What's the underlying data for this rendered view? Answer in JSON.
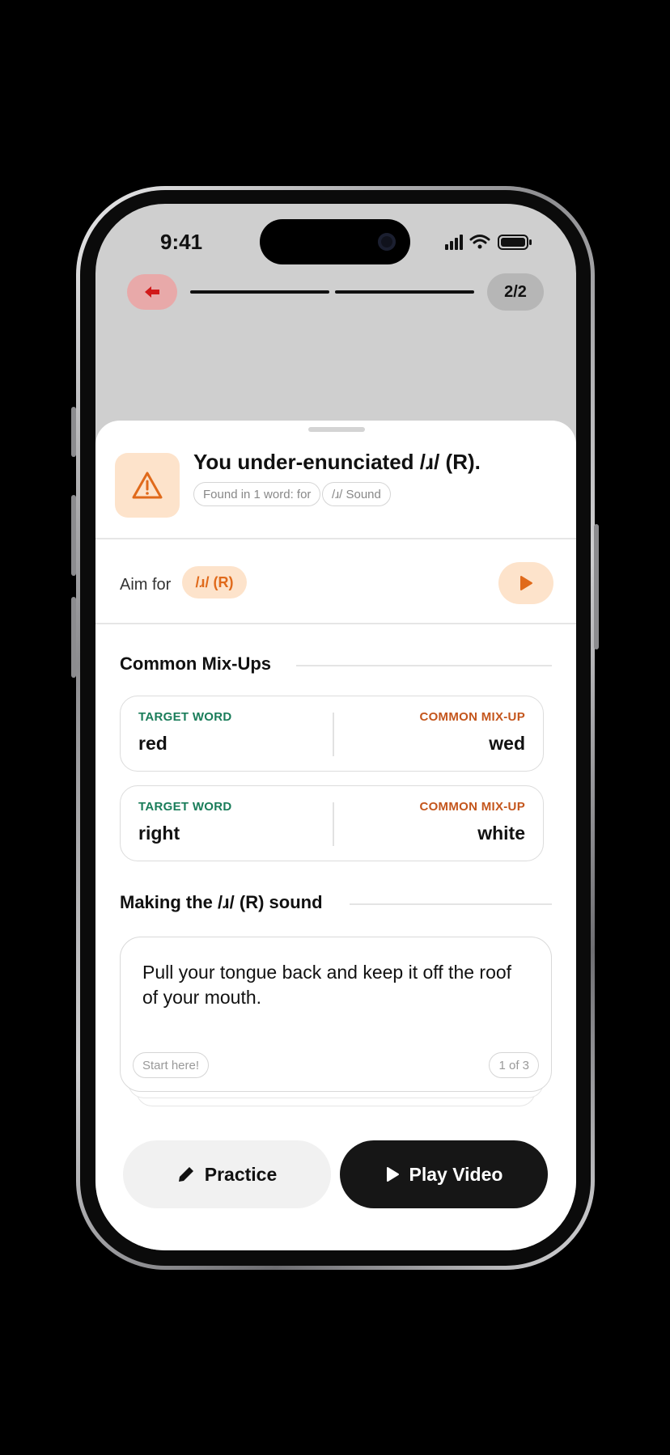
{
  "status_bar": {
    "time": "9:41"
  },
  "nav": {
    "page_indicator": "2/2"
  },
  "issue": {
    "title": "You under-enunciated /ɹ/ (R).",
    "found_chip": "Found in 1 word: for",
    "sound_chip": "/ɹ/ Sound"
  },
  "aim": {
    "label": "Aim for",
    "sound": "/ɹ/ (R)"
  },
  "mixups": {
    "title": "Common Mix-Ups",
    "target_label": "TARGET WORD",
    "mixup_label": "COMMON MIX-UP",
    "rows": [
      {
        "target": "red",
        "mixup": "wed"
      },
      {
        "target": "right",
        "mixup": "white"
      }
    ]
  },
  "making": {
    "title": "Making the /ɹ/ (R) sound",
    "tip": "Pull your tongue back and keep it off the roof of your mouth.",
    "start_chip": "Start here!",
    "counter": "1 of 3"
  },
  "actions": {
    "practice": "Practice",
    "play_video": "Play Video"
  },
  "colors": {
    "accent_orange": "#e06a1b",
    "accent_orange_light": "#fde3cb",
    "target_green": "#1a7d5a",
    "mixup_orange": "#c4561d",
    "back_red": "#d11a1a"
  },
  "icons": {
    "back": "arrow-left-icon",
    "warning": "warning-triangle-icon",
    "play": "play-icon",
    "practice": "pencil-icon"
  }
}
